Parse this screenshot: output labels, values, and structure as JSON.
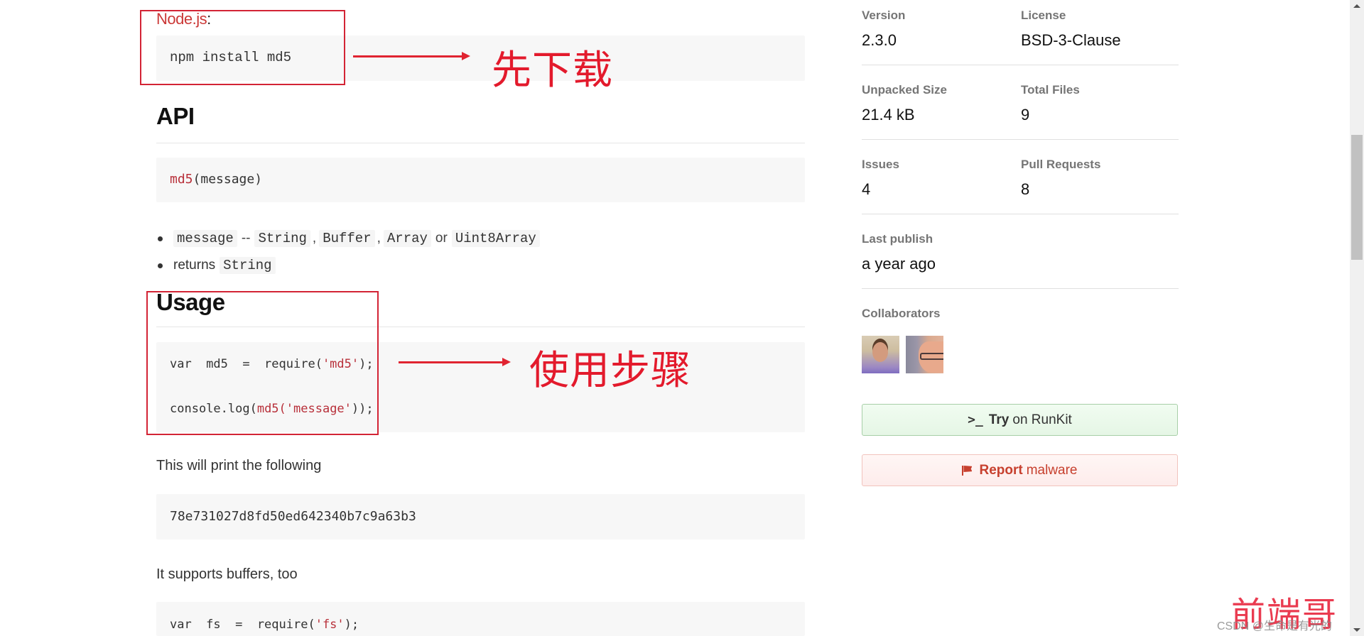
{
  "readme": {
    "install": {
      "label": "Node.js",
      "colon": ":",
      "command": "npm install md5"
    },
    "api": {
      "heading": "API",
      "signature_fn": "md5",
      "signature_args": "(message)",
      "bullets": [
        {
          "param": "message",
          "dash": "--",
          "types": [
            "String",
            "Buffer",
            "Array"
          ],
          "or": "or",
          "last_type": "Uint8Array"
        },
        {
          "text": "returns",
          "type": "String"
        }
      ]
    },
    "usage": {
      "heading": "Usage",
      "line1_a": "var  md5  =  require(",
      "line1_str": "'md5'",
      "line1_b": ");",
      "line2_a": "console.log(",
      "line2_fn": "md5(",
      "line2_str": "'message'",
      "line2_b": "));"
    },
    "print_text": "This will print the following",
    "hash_output": "78e731027d8fd50ed642340b7c9a63b3",
    "buffers_text": "It supports buffers, too",
    "buffers_code_a": "var  fs  =  require(",
    "buffers_code_str": "'fs'",
    "buffers_code_b": ");"
  },
  "annotations": {
    "download": "先下载",
    "usage_steps": "使用步骤"
  },
  "sidebar": {
    "version_label": "Version",
    "version": "2.3.0",
    "license_label": "License",
    "license": "BSD-3-Clause",
    "unpacked_size_label": "Unpacked Size",
    "unpacked_size": "21.4 kB",
    "total_files_label": "Total Files",
    "total_files": "9",
    "issues_label": "Issues",
    "issues": "4",
    "pull_requests_label": "Pull Requests",
    "pull_requests": "8",
    "last_publish_label": "Last publish",
    "last_publish": "a year ago",
    "collaborators_label": "Collaborators",
    "runkit_icon": ">_",
    "runkit_bold": "Try",
    "runkit_rest": "on RunKit",
    "report_bold": "Report",
    "report_rest": "malware"
  },
  "watermark": {
    "cn": "前端哥",
    "csdn": "CSDN @生命是有光的"
  },
  "colors": {
    "npm_red": "#cb3837",
    "annotation_red": "#e31a2c",
    "runkit_green_bg": "#e5f6e5",
    "report_red_bg": "#fdeceb"
  }
}
